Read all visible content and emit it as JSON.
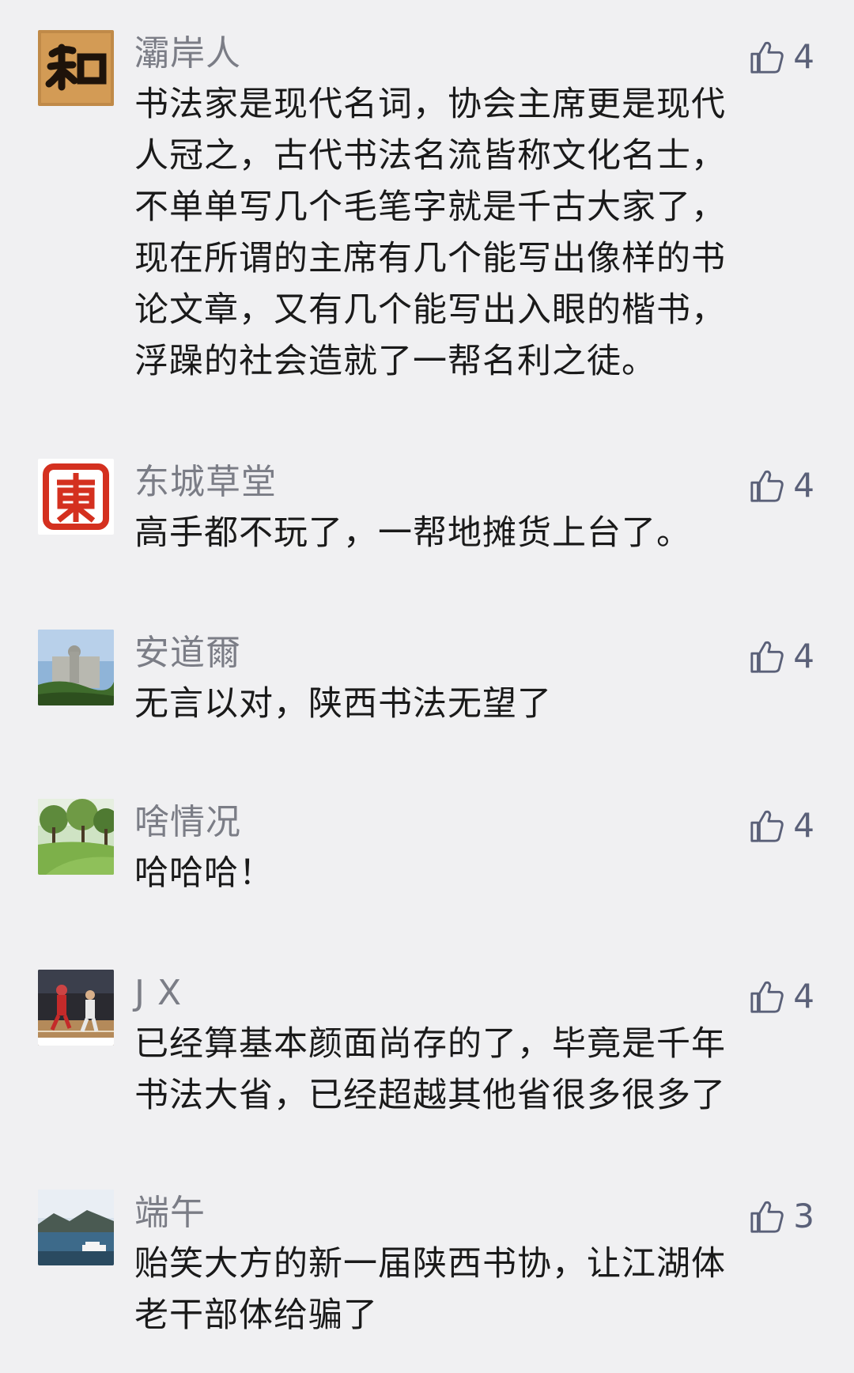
{
  "comments": [
    {
      "nickname": "灞岸人",
      "likes": "4",
      "avatar_icon": "calligraphy-he-icon",
      "lines": [
        "书法家是现代名词，协会主席更是现代",
        "人冠之，古代书法名流皆称文化名士，",
        "不单单写几个毛笔字就是千古大家了，",
        "现在所谓的主席有几个能写出像样的书",
        "论文章，又有几个能写出入眼的楷书，",
        "浮躁的社会造就了一帮名利之徒。"
      ]
    },
    {
      "nickname": "东城草堂",
      "likes": "4",
      "avatar_icon": "seal-dong-icon",
      "lines": [
        "高手都不玩了，一帮地摊货上台了。"
      ]
    },
    {
      "nickname": "安道爾",
      "likes": "4",
      "avatar_icon": "monument-photo-icon",
      "lines": [
        "无言以对，陕西书法无望了"
      ]
    },
    {
      "nickname": "啥情况",
      "likes": "4",
      "avatar_icon": "park-photo-icon",
      "lines": [
        "哈哈哈！"
      ]
    },
    {
      "nickname": "J X",
      "likes": "4",
      "avatar_icon": "basketball-photo-icon",
      "lines": [
        "已经算基本颜面尚存的了，毕竟是千年",
        "书法大省，已经超越其他省很多很多了"
      ]
    },
    {
      "nickname": "端午",
      "likes": "3",
      "avatar_icon": "lake-photo-icon",
      "lines": [
        "贻笑大方的新一届陕西书协，让江湖体",
        "老干部体给骗了"
      ]
    }
  ],
  "colors": {
    "background": "#f0f0f2",
    "nickname": "#7b7d86",
    "content": "#1a1a1a",
    "like_icon": "#5a6078"
  }
}
